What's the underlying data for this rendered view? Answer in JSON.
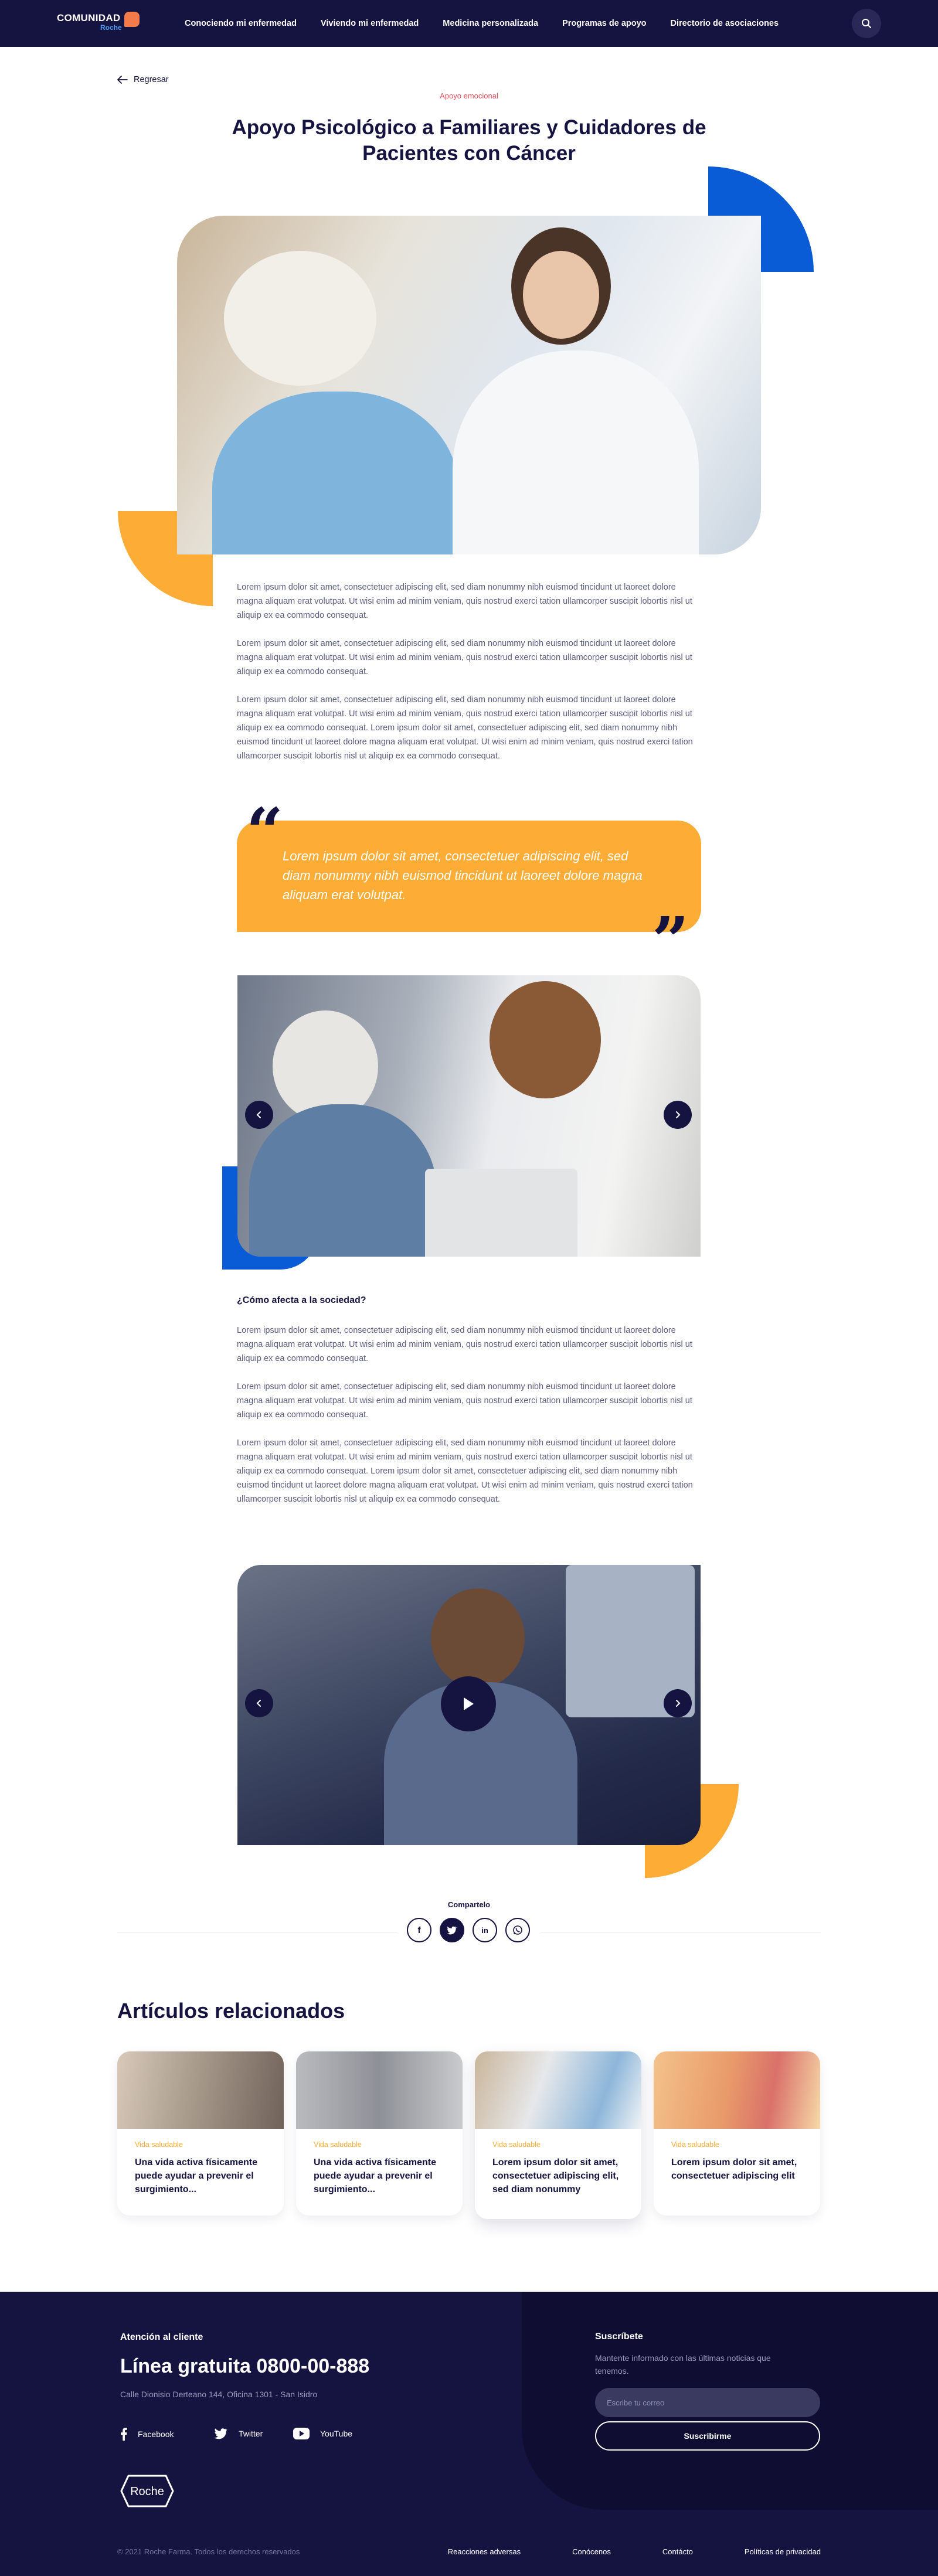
{
  "header": {
    "logo_main": "COMUNIDAD",
    "logo_sub": "Roche",
    "nav": [
      "Conociendo mi enfermedad",
      "Viviendo mi enfermedad",
      "Medicina personalizada",
      "Programas de apoyo",
      "Directorio de asociaciones"
    ]
  },
  "article": {
    "back_label": "Regresar",
    "eyebrow": "Apoyo emocional",
    "title": "Apoyo Psicológico a Familiares y Cuidadores de Pacientes con Cáncer",
    "paragraphs_a": [
      "Lorem ipsum dolor sit amet, consectetuer adipiscing elit, sed diam nonummy nibh euismod tincidunt ut laoreet dolore magna aliquam erat volutpat. Ut wisi enim ad minim veniam, quis nostrud exerci tation ullamcorper suscipit lobortis nisl ut aliquip ex ea commodo consequat.",
      "Lorem ipsum dolor sit amet, consectetuer adipiscing elit, sed diam nonummy nibh euismod tincidunt ut laoreet dolore magna aliquam erat volutpat. Ut wisi enim ad minim veniam, quis nostrud exerci tation ullamcorper suscipit lobortis nisl ut aliquip ex ea commodo consequat.",
      "Lorem ipsum dolor sit amet, consectetuer adipiscing elit, sed diam nonummy nibh euismod tincidunt ut laoreet dolore magna aliquam erat volutpat. Ut wisi enim ad minim veniam, quis nostrud exerci tation ullamcorper suscipit lobortis nisl ut aliquip ex ea commodo consequat. Lorem ipsum dolor sit amet, consectetuer adipiscing elit, sed diam nonummy nibh euismod tincidunt ut laoreet dolore magna aliquam erat volutpat. Ut wisi enim ad minim veniam, quis nostrud exerci tation ullamcorper suscipit lobortis nisl ut aliquip ex ea commodo consequat."
    ],
    "quote": "Lorem ipsum dolor sit amet, consectetuer adipiscing elit, sed diam nonummy nibh euismod tincidunt ut laoreet dolore magna aliquam erat volutpat.",
    "subheading": "¿Cómo afecta a la sociedad?",
    "paragraphs_b": [
      "Lorem ipsum dolor sit amet, consectetuer adipiscing elit, sed diam nonummy nibh euismod tincidunt ut laoreet dolore magna aliquam erat volutpat. Ut wisi enim ad minim veniam, quis nostrud exerci tation ullamcorper suscipit lobortis nisl ut aliquip ex ea commodo consequat.",
      "Lorem ipsum dolor sit amet, consectetuer adipiscing elit, sed diam nonummy nibh euismod tincidunt ut laoreet dolore magna aliquam erat volutpat. Ut wisi enim ad minim veniam, quis nostrud exerci tation ullamcorper suscipit lobortis nisl ut aliquip ex ea commodo consequat.",
      "Lorem ipsum dolor sit amet, consectetuer adipiscing elit, sed diam nonummy nibh euismod tincidunt ut laoreet dolore magna aliquam erat volutpat. Ut wisi enim ad minim veniam, quis nostrud exerci tation ullamcorper suscipit lobortis nisl ut aliquip ex ea commodo consequat. Lorem ipsum dolor sit amet, consectetuer adipiscing elit, sed diam nonummy nibh euismod tincidunt ut laoreet dolore magna aliquam erat volutpat. Ut wisi enim ad minim veniam, quis nostrud exerci tation ullamcorper suscipit lobortis nisl ut aliquip ex ea commodo consequat."
    ]
  },
  "share": {
    "label": "Compartelo",
    "icons": [
      "facebook-icon",
      "twitter-icon",
      "linkedin-icon",
      "whatsapp-icon"
    ]
  },
  "related": {
    "title": "Artículos relacionados",
    "cards": [
      {
        "tag": "Vida saludable",
        "title": "Una vida activa físicamente puede ayudar a prevenir el surgimiento..."
      },
      {
        "tag": "Vida saludable",
        "title": "Una vida activa físicamente puede ayudar a prevenir el surgimiento..."
      },
      {
        "tag": "Vida saludable",
        "title": "Lorem ipsum dolor sit amet, consectetuer adipiscing elit, sed diam nonummy"
      },
      {
        "tag": "Vida saludable",
        "title": "Lorem ipsum dolor sit amet, consectetuer adipiscing elit"
      }
    ]
  },
  "footer": {
    "attention": "Atención al cliente",
    "phone": "Línea gratuita 0800-00-888",
    "address": "Calle Dionisio Derteano 144, Oficina 1301 - San Isidro",
    "social": [
      "Facebook",
      "Twitter",
      "YouTube"
    ],
    "brand": "Roche",
    "subscribe_title": "Suscríbete",
    "subscribe_text": "Mantente informado con las últimas noticias que tenemos.",
    "subscribe_placeholder": "Escribe tu correo",
    "subscribe_button": "Suscribirme",
    "copyright": "© 2021 Roche Farma. Todos los derechos reservados",
    "links": [
      "Reacciones adversas",
      "Conócenos",
      "Contácto",
      "Políticas de privacidad"
    ]
  },
  "colors": {
    "navy": "#15133f",
    "blue": "#0a5bd6",
    "yellow": "#fdac35",
    "red": "#e8535f"
  }
}
